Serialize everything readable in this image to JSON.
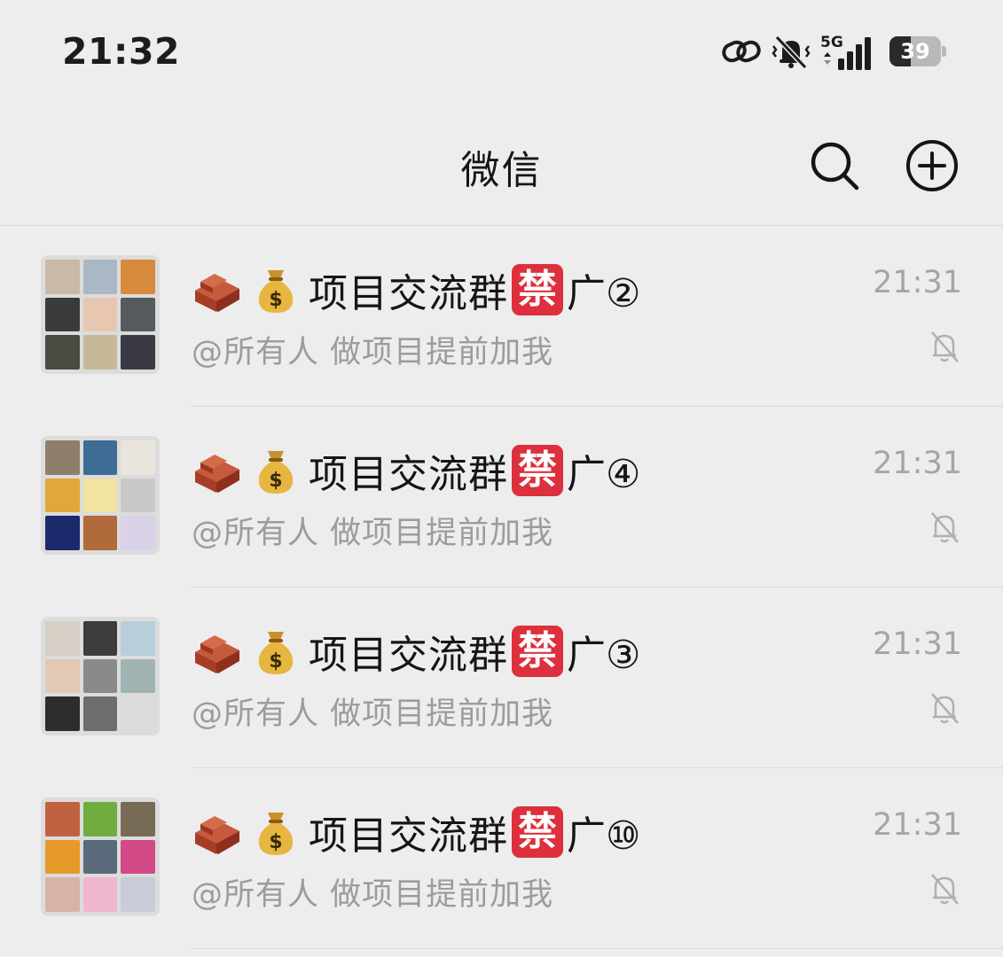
{
  "status_bar": {
    "time": "21:32",
    "network": "5G",
    "battery": "39",
    "icons": [
      "link-icon",
      "mute-vibrate-icon",
      "signal-5g-icon",
      "battery-icon"
    ]
  },
  "header": {
    "title": "微信",
    "icons": [
      "search-icon",
      "add-icon"
    ]
  },
  "chats": [
    {
      "prefix_emojis": [
        "brick-emoji",
        "money-bag-emoji"
      ],
      "name_main": "项目交流群",
      "badge": "禁",
      "name_suffix": "广②",
      "preview": "@所有人 做项目提前加我",
      "time": "21:31",
      "muted": true,
      "avatar_colors": [
        "#c9b9a8",
        "#aab7c4",
        "#d88a3c",
        "#3b3b3b",
        "#e7c7b0",
        "#555a5e",
        "#4a4a42",
        "#c8b89a",
        "#3a3a44"
      ]
    },
    {
      "prefix_emojis": [
        "brick-emoji",
        "money-bag-emoji"
      ],
      "name_main": "项目交流群",
      "badge": "禁",
      "name_suffix": "广④",
      "preview": "@所有人 做项目提前加我",
      "time": "21:31",
      "muted": true,
      "avatar_colors": [
        "#8e7f6a",
        "#3f6c94",
        "#e9e4dc",
        "#e0a73a",
        "#f2e3a2",
        "#c8c8c8",
        "#1c2a6b",
        "#b06a3c",
        "#d9d2e6"
      ]
    },
    {
      "prefix_emojis": [
        "brick-emoji",
        "money-bag-emoji"
      ],
      "name_main": "项目交流群",
      "badge": "禁",
      "name_suffix": "广③",
      "preview": "@所有人 做项目提前加我",
      "time": "21:31",
      "muted": true,
      "avatar_colors": [
        "#d6cfc6",
        "#3d3d3d",
        "#b7cfd8",
        "#e3c8b6",
        "#8a8a8a",
        "#9fb3b3",
        "#2c2c2c",
        "#6d6d6d",
        "#dcdcdc"
      ]
    },
    {
      "prefix_emojis": [
        "brick-emoji",
        "money-bag-emoji"
      ],
      "name_main": "项目交流群",
      "badge": "禁",
      "name_suffix": "广⑩",
      "preview": "@所有人 做项目提前加我",
      "time": "21:31",
      "muted": true,
      "avatar_colors": [
        "#c0623f",
        "#6fae3e",
        "#786b55",
        "#e59a2a",
        "#5a6a7a",
        "#d24a87",
        "#d6b3a6",
        "#f0b6d0",
        "#c9ccd6"
      ]
    }
  ],
  "colors": {
    "background": "#ededed",
    "badge_red": "#dd2f3c",
    "muted_text": "#9c9c9c"
  }
}
